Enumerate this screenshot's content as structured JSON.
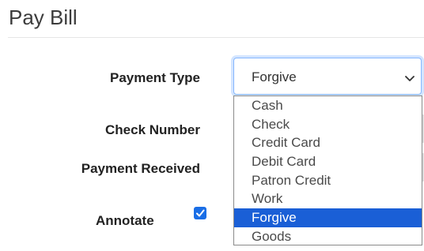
{
  "page": {
    "title": "Pay Bill"
  },
  "form": {
    "payment_type_label": "Payment Type",
    "check_number_label": "Check Number",
    "payment_received_label": "Payment Received",
    "annotate_label": "Annotate",
    "annotate_checked": true
  },
  "payment_type_select": {
    "value": "Forgive",
    "options": [
      "Cash",
      "Check",
      "Credit Card",
      "Debit Card",
      "Patron Credit",
      "Work",
      "Forgive",
      "Goods"
    ],
    "highlighted": "Forgive",
    "accent_color": "#1a5fd6"
  },
  "icons": {
    "select_arrow": "chevron-down-icon",
    "checkbox_mark": "checkmark-icon"
  }
}
